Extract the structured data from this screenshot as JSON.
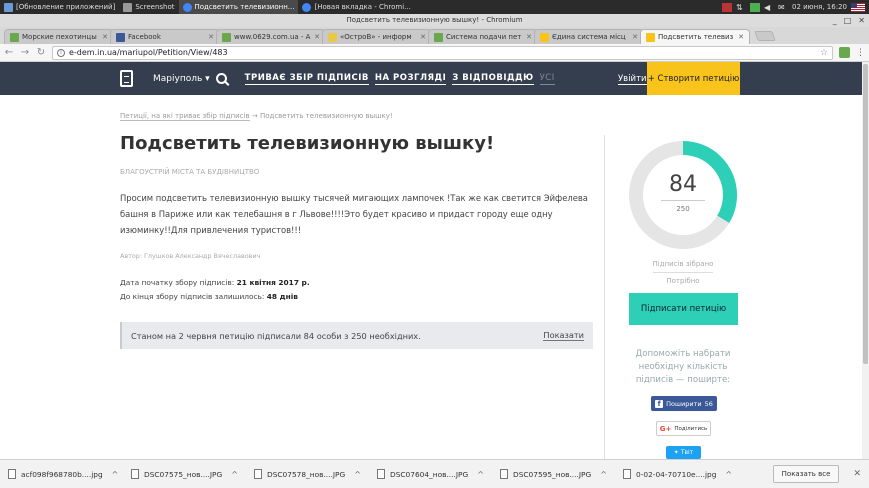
{
  "os": {
    "taskbar_items": [
      {
        "label": "[Обновление приложений]",
        "color": "#6a9bd8",
        "active": false
      },
      {
        "label": "Screenshot",
        "color": "#999",
        "active": false
      },
      {
        "label": "Подсветить телевизионн...",
        "color": "#4285f4",
        "active": true
      },
      {
        "label": "[Новая вкладка - Chromi...",
        "color": "#4285f4",
        "active": false
      }
    ],
    "clock": "02 июня, 16:20"
  },
  "window": {
    "title": "Подсветить телевизионную вышку! - Chromium",
    "controls": [
      "_",
      "□",
      "✕"
    ]
  },
  "tabs": [
    {
      "label": "Морские пехотинцы",
      "color": "#6aa84f",
      "active": false
    },
    {
      "label": "Facebook",
      "color": "#3b5998",
      "active": false
    },
    {
      "label": "www.0629.com.ua - А",
      "color": "#6aa84f",
      "active": false
    },
    {
      "label": "«ОстроВ» - информ",
      "color": "#e8c84a",
      "active": false
    },
    {
      "label": "Система подачи пет",
      "color": "#6aa84f",
      "active": false
    },
    {
      "label": "Єдина система місц",
      "color": "#f8c41c",
      "active": false
    },
    {
      "label": "Подсветить телевиз",
      "color": "#f8c41c",
      "active": true
    }
  ],
  "address": {
    "url": "e-dem.in.ua/mariupol/Petition/View/483"
  },
  "site": {
    "city": "Маріуполь",
    "nav": [
      {
        "label": "ТРИВАЄ ЗБІР ПІДПИСІВ",
        "dim": false
      },
      {
        "label": "НА РОЗГЛЯДІ",
        "dim": false
      },
      {
        "label": "З ВІДПОВІДДЮ",
        "dim": false
      },
      {
        "label": "УСІ",
        "dim": true
      }
    ],
    "login": "Увійти",
    "create": "+ Створити петицію"
  },
  "petition": {
    "crumb_link": "Петиції, на які триває збір підписів",
    "crumb_current": "→ Подсветить телевизионную вышку!",
    "title": "Подсветить телевизионную вышку!",
    "category": "БЛАГОУСТРІЙ МІСТА ТА БУДІВНИЦТВО",
    "text": "Просим подсветить телевизионную вышку тысячей мигающих лампочек !Так же как светится Эйфелева башня в Париже или как телебашня в г Львове!!!!Это будет красиво и придаст городу еще одну изюминку!!Для привлечения туристов!!!",
    "author": "Автор: Глушков Александр Вячеславович",
    "start_label": "Дата початку збору підписів:",
    "start_value": "21 квітня 2017 р.",
    "left_label": "До кінця збору підписів залишилось:",
    "left_value": "48 днів",
    "status_text": "Станом на 2 червня петицію підписали 84 особи з 250 необхідних.",
    "show_link": "Показати"
  },
  "sidebar": {
    "collected": 84,
    "needed": 250,
    "progress": 0.336,
    "collected_label": "Підписів зібрано",
    "needed_label": "Потрібно",
    "sign_button": "Підписати петицію",
    "help_text": "Допоможіть набрати необхідну кількість підписів — поширте:",
    "fb_label": "Поширити",
    "fb_count": "56",
    "gp_label": "Поділитись",
    "tw_label": "Твіт",
    "accent": "#2dcfb6"
  },
  "downloads": {
    "items": [
      "acf098f968780b....jpg",
      "DSC07575_нов....JPG",
      "DSC07578_нов....JPG",
      "DSC07604_нов....JPG",
      "DSC07595_нов....JPG",
      "0-02-04-70710e....jpg"
    ],
    "show_all": "Показать все"
  }
}
